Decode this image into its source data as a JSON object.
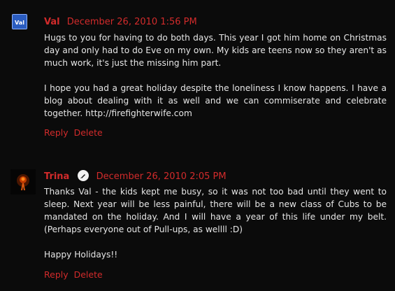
{
  "comments": [
    {
      "author": "Val",
      "date": "December 26, 2010 1:56 PM",
      "paragraphs": [
        "Hugs to you for having to do both days. This year I got him home on Christmas day and only had to do Eve on my own. My kids are teens now so they aren't as much work, it's just the missing him part.",
        "I hope you had a great holiday despite the loneliness I know happens. I have a blog about dealing with it as well and we can commiserate and celebrate together. http://firefighterwife.com"
      ],
      "actions": {
        "reply": "Reply",
        "delete": "Delete"
      },
      "avatar_text": "Val"
    },
    {
      "author": "Trina",
      "date": "December 26, 2010 2:05 PM",
      "paragraphs": [
        "Thanks Val - the kids kept me busy, so it was not too bad until they went to sleep. Next year will be less painful, there will be a new class of Cubs to be mandated on the holiday. And I will have a year of this life under my belt. (Perhaps everyone out of Pull-ups, as wellll :D)",
        "Happy Holidays!!"
      ],
      "actions": {
        "reply": "Reply",
        "delete": "Delete"
      }
    }
  ],
  "colors": {
    "background": "#0b0b0b",
    "accent": "#d22b2b",
    "text": "#e6e6e6"
  }
}
